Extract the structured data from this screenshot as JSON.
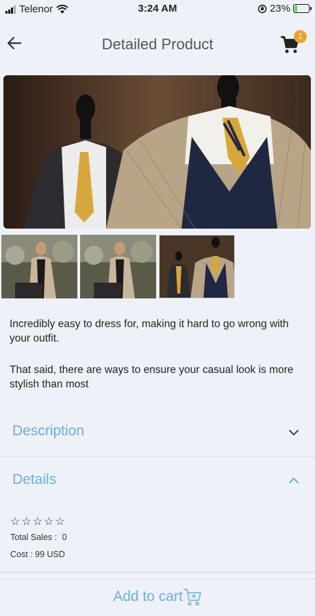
{
  "status_bar": {
    "carrier": "Telenor",
    "time": "3:24 AM",
    "battery": "23%",
    "battery_level": 0.23,
    "icons": [
      "signal-icon",
      "wifi-icon",
      "orientation-lock-icon",
      "battery-icon"
    ]
  },
  "header": {
    "title": "Detailed Product",
    "cart_count": "1",
    "icons": [
      "back-arrow-icon",
      "cart-icon"
    ],
    "badge_color": "#f0a030"
  },
  "product": {
    "para1": "Incredibly easy to dress for, making it hard to go wrong with your outfit.",
    "para2": "That said, there are ways to ensure your casual look is more stylish than most"
  },
  "sections": {
    "description_label": "Description",
    "details_label": "Details",
    "accent_color": "#6aaee6"
  },
  "details": {
    "rating": 0,
    "rating_max": 5,
    "total_sales_label": "Total Sales :",
    "total_sales_value": "0",
    "cost_label": "Cost :",
    "cost_value": "99 USD"
  },
  "footer": {
    "add_to_cart": "Add to cart"
  }
}
